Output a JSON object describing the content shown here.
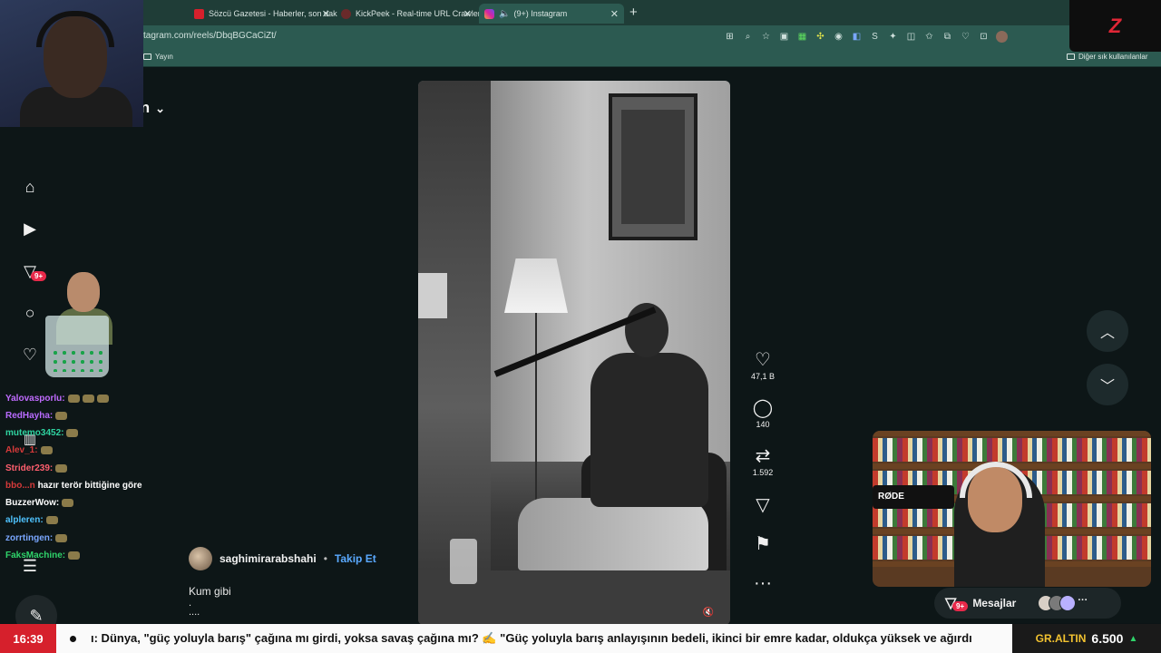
{
  "browser": {
    "tabs": [
      {
        "label": "Sözcü Gazetesi - Haberler, son dak",
        "color": "#d6202c"
      },
      {
        "label": "KickPeek - Real-time URL Crawler",
        "color": "#3a3a3a"
      },
      {
        "label": "(9+) Instagram",
        "color": "#d6249f"
      }
    ],
    "url": "tagram.com/reels/DbqBGCaCiZt/",
    "bookmark_left": "Yayın",
    "bookmark_right": "Diğer sık kullanılanlar"
  },
  "page": {
    "title_fragment": "in",
    "nav_badge": "9+"
  },
  "reel": {
    "likes": "47,1 B",
    "comments": "140",
    "reposts": "1.592",
    "author": "saghimirarabshahi",
    "separator": "•",
    "follow_label": "Takip Et",
    "caption": "Kum gibi",
    "caption_more": ".",
    "caption_dots": "...."
  },
  "messages": {
    "label": "Mesajlar",
    "badge": "9+"
  },
  "stream_overlay": {
    "logo": "Z",
    "cam_mic_label": "RØDE",
    "chat": [
      {
        "user": "Yalovasporlu:",
        "color": "#c06bff",
        "msg": "",
        "emotes": 3
      },
      {
        "user": "RedHayha:",
        "color": "#b86bff",
        "msg": "",
        "emotes": 1
      },
      {
        "user": "mutemo3452:",
        "color": "#2fd3a0",
        "msg": "",
        "emotes": 1
      },
      {
        "user": "Alev_1:",
        "color": "#d63a3a",
        "msg": "",
        "emotes": 1
      },
      {
        "user": "Strider239:",
        "color": "#ff5f6e",
        "msg": "",
        "emotes": 1
      },
      {
        "user": "bbo...n",
        "color": "#d63a3a",
        "msg": "hazır terör bittiğine göre",
        "emotes": 0
      },
      {
        "user": "BuzzerWow:",
        "color": "#ffffff",
        "msg": "",
        "emotes": 1
      },
      {
        "user": "alpleren:",
        "color": "#4fc3ff",
        "msg": "",
        "emotes": 1
      },
      {
        "user": "zorrtingen:",
        "color": "#7aa7ff",
        "msg": "",
        "emotes": 1
      },
      {
        "user": "FaksMachine:",
        "color": "#2fd36a",
        "msg": "",
        "emotes": 1
      }
    ]
  },
  "ticker": {
    "time": "16:39",
    "text": "ı: Dünya, \"güç yoluyla barış\" çağına mı girdi, yoksa savaş çağına mı? ✍ \"Güç yoluyla barış anlayışının bedeli, ikinci bir emre kadar, oldukça yüksek ve ağırdı",
    "gold_label": "GR.ALTIN",
    "gold_value": "6.500",
    "gold_trend": "▲"
  }
}
